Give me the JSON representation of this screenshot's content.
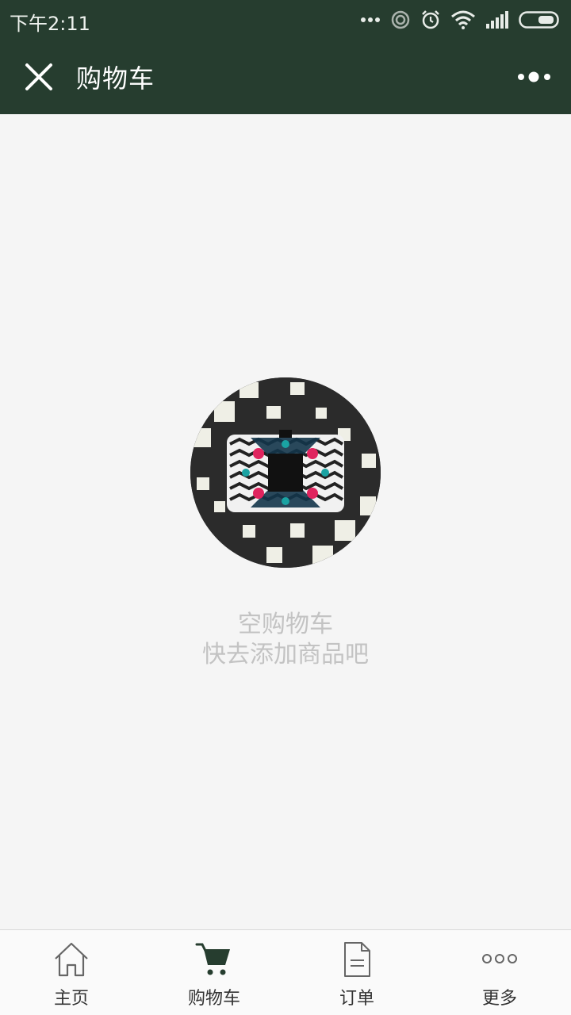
{
  "status_bar": {
    "time": "下午2:11"
  },
  "nav": {
    "title": "购物车",
    "close_icon": "close-icon",
    "more_icon": "more-dots-icon",
    "background": "#263d2f"
  },
  "empty_state": {
    "image": "handbag-product-image",
    "title": "空购物车",
    "subtitle": "快去添加商品吧",
    "text_color": "#c3c3c3"
  },
  "tabs": [
    {
      "label": "主页",
      "icon": "home-icon",
      "active": false
    },
    {
      "label": "购物车",
      "icon": "cart-icon",
      "active": true
    },
    {
      "label": "订单",
      "icon": "document-icon",
      "active": false
    },
    {
      "label": "更多",
      "icon": "more-icon",
      "active": false
    }
  ],
  "colors": {
    "accent": "#263d2f",
    "background": "#f5f5f5"
  }
}
